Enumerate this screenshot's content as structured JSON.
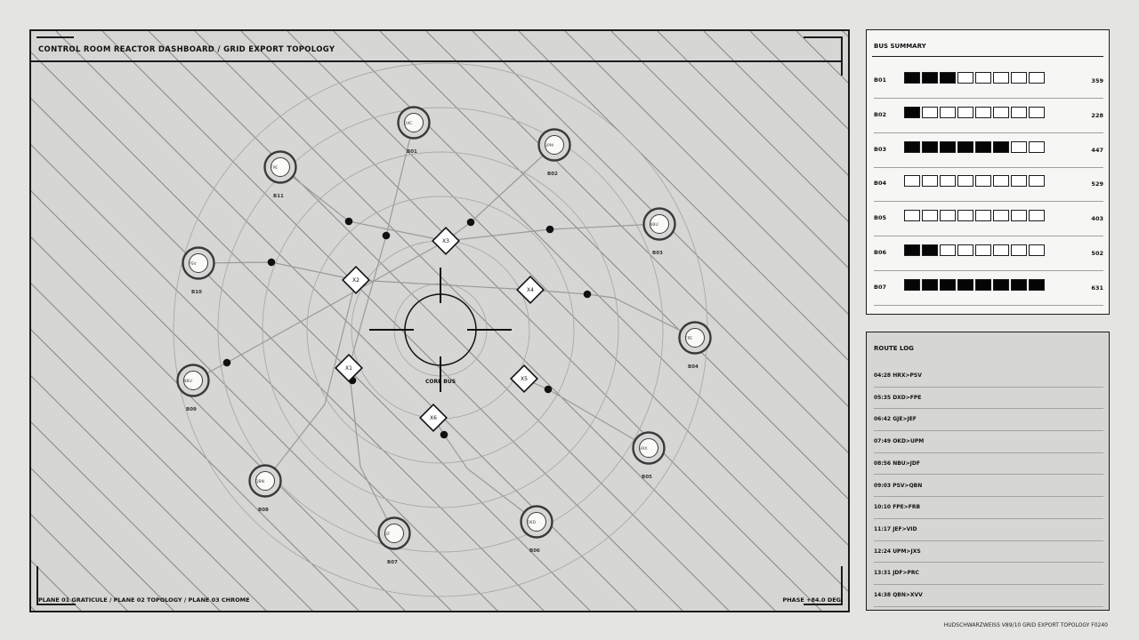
{
  "header": {
    "title": "CONTROL ROOM REACTOR DASHBOARD  /  GRID EXPORT TOPOLOGY"
  },
  "footer": {
    "planes": "PLANE 01 GRATICULE  /  PLANE 02 TOPOLOGY  /  PLANE 03 CHROME",
    "phase": "PHASE +84.0 DEG"
  },
  "topology": {
    "core_label": "CORE BUS",
    "buses": [
      {
        "id": "B01",
        "code": "DXC"
      },
      {
        "id": "B02",
        "code": "UPM"
      },
      {
        "id": "B03",
        "code": "NBU"
      },
      {
        "id": "B04",
        "code": "FPE"
      },
      {
        "id": "B05",
        "code": "HRX"
      },
      {
        "id": "B06",
        "code": "OKD"
      },
      {
        "id": "B07",
        "code": "JEF"
      },
      {
        "id": "B08",
        "code": "QBN"
      },
      {
        "id": "B09",
        "code": "NBU"
      },
      {
        "id": "B10",
        "code": "PSV"
      },
      {
        "id": "B11",
        "code": "FPE"
      }
    ],
    "junctions": [
      "X1",
      "X2",
      "X3",
      "X4",
      "X5",
      "X6"
    ]
  },
  "bus_summary": {
    "title": "BUS SUMMARY",
    "rows": [
      {
        "id": "B01",
        "filled": 3,
        "total": 8,
        "value": "359"
      },
      {
        "id": "B02",
        "filled": 1,
        "total": 8,
        "value": "228"
      },
      {
        "id": "B03",
        "filled": 6,
        "total": 8,
        "value": "447"
      },
      {
        "id": "B04",
        "filled": 0,
        "total": 8,
        "value": "529"
      },
      {
        "id": "B05",
        "filled": 0,
        "total": 8,
        "value": "403"
      },
      {
        "id": "B06",
        "filled": 2,
        "total": 8,
        "value": "502"
      },
      {
        "id": "B07",
        "filled": 8,
        "total": 8,
        "value": "631"
      }
    ]
  },
  "route_log": {
    "title": "ROUTE LOG",
    "entries": [
      "04:28 HRX>PSV",
      "05:35 DXD>FPE",
      "06:42 GJE>JEF",
      "07:49 OKD>UPM",
      "08:56 NBU>JDF",
      "09:03 PSV>QBN",
      "10:10 FPE>FRB",
      "11:17 JEF>VID",
      "12:24 UPM>JXS",
      "13:31 JDF>PRC",
      "14:38 QBN>XVV"
    ]
  },
  "caption": "HUDSCHWARZWEISS  V89/10  GRID EXPORT TOPOLOGY  F0240",
  "colors": {
    "ink": "#111111",
    "panel": "#d6d7d5",
    "paper": "#f6f7f5",
    "background": "#e4e5e3"
  }
}
